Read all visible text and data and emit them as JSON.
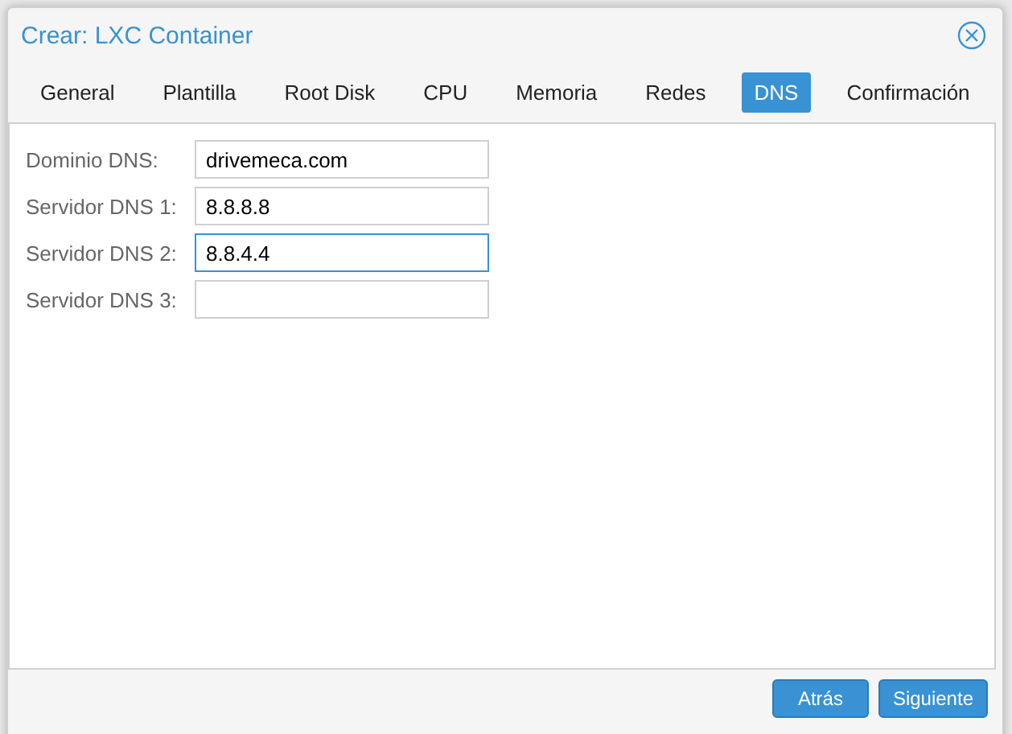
{
  "window": {
    "title": "Crear: LXC Container"
  },
  "tabs": [
    {
      "label": "General",
      "selected": false
    },
    {
      "label": "Plantilla",
      "selected": false
    },
    {
      "label": "Root Disk",
      "selected": false
    },
    {
      "label": "CPU",
      "selected": false
    },
    {
      "label": "Memoria",
      "selected": false
    },
    {
      "label": "Redes",
      "selected": false
    },
    {
      "label": "DNS",
      "selected": true
    },
    {
      "label": "Confirmación",
      "selected": false
    }
  ],
  "fields": [
    {
      "label": "Dominio DNS:",
      "value": "drivemeca.com",
      "focused": false
    },
    {
      "label": "Servidor DNS 1:",
      "value": "8.8.8.8",
      "focused": false
    },
    {
      "label": "Servidor DNS 2:",
      "value": "8.8.4.4",
      "focused": true
    },
    {
      "label": "Servidor DNS 3:",
      "focused": false
    }
  ],
  "buttons": [
    "Atrás",
    "Siguiente"
  ]
}
